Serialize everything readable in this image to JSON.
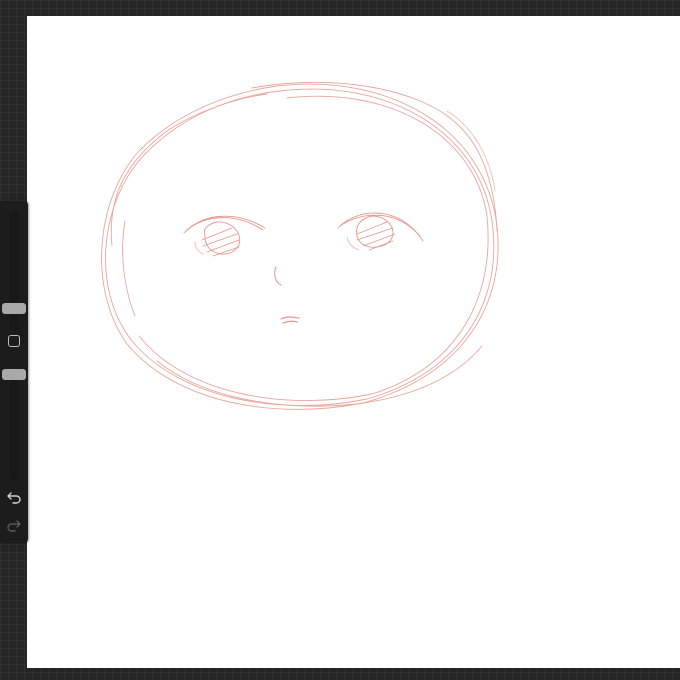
{
  "app": {
    "accent": "#e07a6c",
    "background": "#252525",
    "canvas_color": "#ffffff",
    "sketch_color": "#e6968a"
  },
  "sidebar": {
    "brush_size": 0.36,
    "brush_opacity": 0.18,
    "modify_icon": "square-outline-icon",
    "undo_icon": "undo-arrow-icon",
    "redo_icon": "redo-arrow-icon"
  },
  "canvas": {
    "content": "red-pencil-face-sketch"
  }
}
